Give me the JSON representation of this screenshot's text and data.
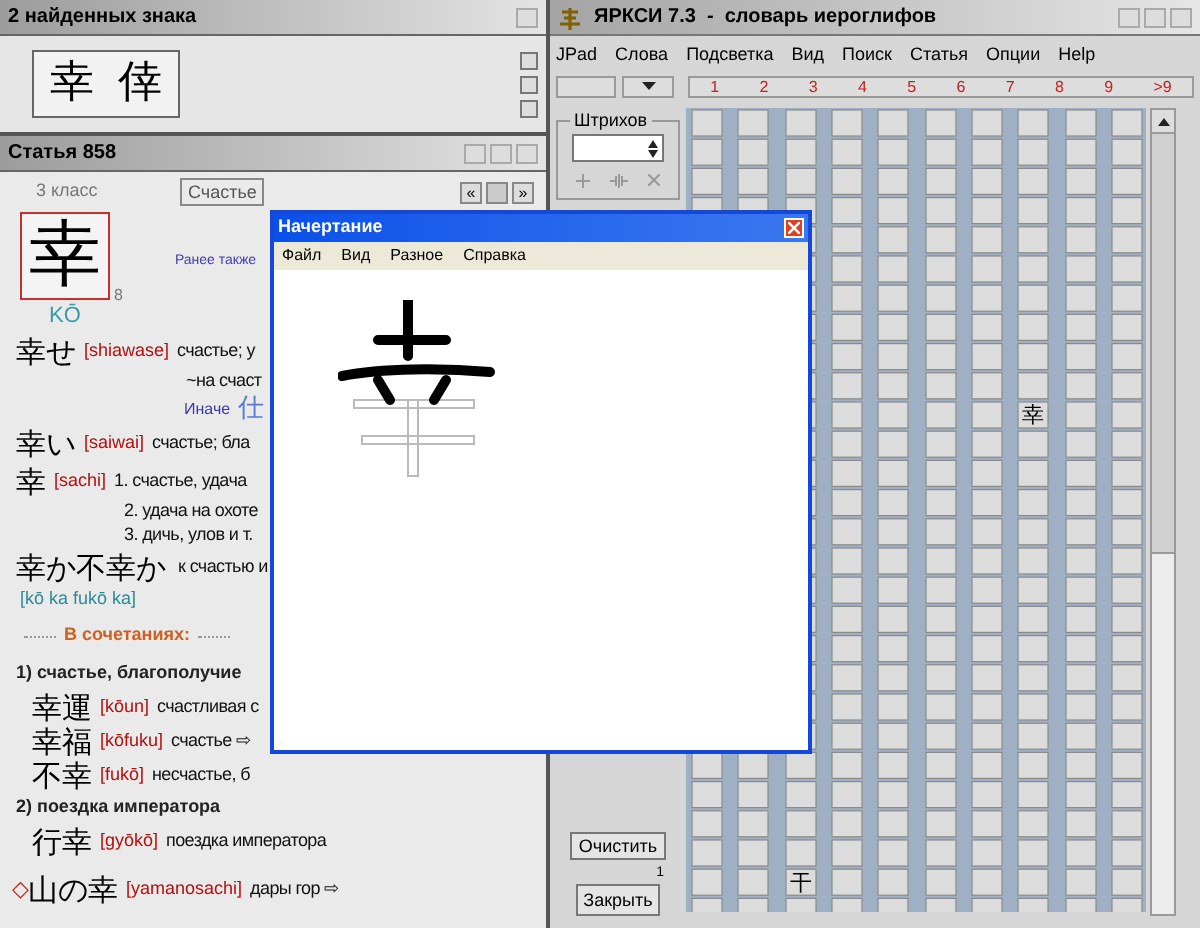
{
  "found_panel": {
    "title": "2 найденных знака",
    "kanji": [
      "幸",
      "倖"
    ]
  },
  "article_panel": {
    "title": "Статья 858",
    "grade": "3 класс",
    "meaning_button": "Счастье",
    "nav": [
      "«",
      "»"
    ],
    "kanji": "幸",
    "strokes": "8",
    "reading": "KŌ",
    "also": "Ранее также",
    "lines": [
      {
        "kind": "word",
        "word": "幸せ",
        "reading": "[shiawase]",
        "text": "счастье; у"
      },
      {
        "kind": "cont",
        "text": "~на счаст"
      },
      {
        "kind": "alt",
        "text": "Иначе",
        "glyph": "仕"
      },
      {
        "kind": "word",
        "word": "幸い",
        "reading": "[saiwai]",
        "text": "счастье; бла"
      },
      {
        "kind": "word",
        "word": "幸",
        "reading": "[sachi]",
        "text": "1. счастье, удача"
      },
      {
        "kind": "sub",
        "text": "2. удача на охоте"
      },
      {
        "kind": "sub",
        "text": "3. дичь, улов и т."
      },
      {
        "kind": "word",
        "word": "幸か不幸か",
        "text": "к счастью и"
      },
      {
        "kind": "romaji",
        "text": "[kō ka fukō ka]"
      },
      {
        "kind": "section",
        "text": "В сочетаниях:"
      },
      {
        "kind": "group",
        "text": "1) счастье, благополучие"
      },
      {
        "kind": "compound",
        "word": "幸運",
        "reading": "[kōun]",
        "text": "счастливая с"
      },
      {
        "kind": "compound",
        "word": "幸福",
        "reading": "[kōfuku]",
        "text": "счастье ⇨"
      },
      {
        "kind": "compound",
        "word": "不幸",
        "reading": "[fukō]",
        "text": "несчастье, б"
      },
      {
        "kind": "group",
        "text": "2) поездка императора"
      },
      {
        "kind": "compound",
        "word": "行幸",
        "reading": "[gyōkō]",
        "text": "поездка императора"
      },
      {
        "kind": "idiom",
        "mark": "◇",
        "word": "山の幸",
        "reading": "[yamanosachi]",
        "text": "дары гор ⇨"
      }
    ]
  },
  "main_window": {
    "title": "ЯРКСИ 7.3  -  словарь иероглифов",
    "menu": [
      "JPad",
      "Слова",
      "Подсветка",
      "Вид",
      "Поиск",
      "Статья",
      "Опции",
      "Help"
    ],
    "stroke_counts": [
      "1",
      "2",
      "3",
      "4",
      "5",
      "6",
      "7",
      "8",
      "9",
      ">9"
    ],
    "strokes_label": "Штрихов",
    "clear_button": "Очистить",
    "count": "1",
    "close_button": "Закрыть",
    "grid_marked": [
      "幸",
      "干"
    ]
  },
  "popup": {
    "title": "Начертание",
    "menu": [
      "Файл",
      "Вид",
      "Разное",
      "Справка"
    ]
  }
}
